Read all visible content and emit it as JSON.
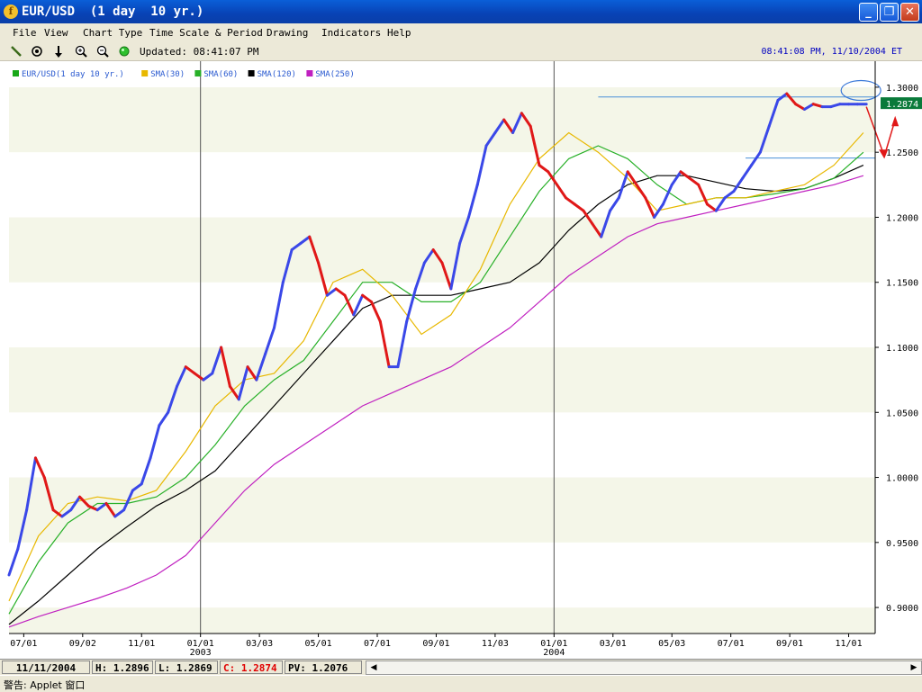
{
  "window": {
    "title": "EUR/USD  (1 day  10 yr.)",
    "app_icon": "forex-logo-icon",
    "buttons": [
      "minimize",
      "maximize",
      "close"
    ]
  },
  "menu": [
    "File",
    "View",
    "Chart Type",
    "Time Scale & Period",
    "Drawing",
    "Indicators",
    "Help"
  ],
  "toolbar": {
    "tools": [
      "pencil-icon",
      "crosshair-icon",
      "arrow-down-icon",
      "zoom-in-icon",
      "zoom-out-icon",
      "refresh-icon"
    ],
    "updated": "Updated: 08:41:07 PM",
    "timestamp": "08:41:08 PM, 11/10/2004 ET"
  },
  "legend": [
    {
      "label": "EUR/USD(1 day  10 yr.)",
      "color": "#18a818"
    },
    {
      "label": "SMA(30)",
      "color": "#e8b800"
    },
    {
      "label": "SMA(60)",
      "color": "#28b028"
    },
    {
      "label": "SMA(120)",
      "color": "#000000"
    },
    {
      "label": "SMA(250)",
      "color": "#c020c0"
    }
  ],
  "chart_data": {
    "type": "line",
    "ylim": [
      0.88,
      1.32
    ],
    "y_ticks": [
      {
        "label": "1.3000",
        "value": 1.3
      },
      {
        "label": "1.2500",
        "value": 1.25
      },
      {
        "label": "1.2000",
        "value": 1.2
      },
      {
        "label": "1.1500",
        "value": 1.15
      },
      {
        "label": "1.1000",
        "value": 1.1
      },
      {
        "label": "1.0500",
        "value": 1.05
      },
      {
        "label": "1.0000",
        "value": 1.0
      },
      {
        "label": "0.9500",
        "value": 0.95
      },
      {
        "label": "0.9000",
        "value": 0.9
      }
    ],
    "x_ticks": [
      {
        "label": "07/01",
        "x": 0.5
      },
      {
        "label": "09/02",
        "x": 2.5
      },
      {
        "label": "11/01",
        "x": 4.5
      },
      {
        "label": "01/01",
        "x": 6.5
      },
      {
        "label": "03/03",
        "x": 8.5
      },
      {
        "label": "05/01",
        "x": 10.5
      },
      {
        "label": "07/01",
        "x": 12.5
      },
      {
        "label": "09/01",
        "x": 14.5
      },
      {
        "label": "11/03",
        "x": 16.5
      },
      {
        "label": "01/01",
        "x": 18.5
      },
      {
        "label": "03/01",
        "x": 20.5
      },
      {
        "label": "05/03",
        "x": 22.5
      },
      {
        "label": "07/01",
        "x": 24.5
      },
      {
        "label": "09/01",
        "x": 26.5
      },
      {
        "label": "11/01",
        "x": 28.5
      }
    ],
    "year_labels": [
      {
        "label": "2003",
        "x": 6.5
      },
      {
        "label": "2004",
        "x": 18.5
      }
    ],
    "year_dividers": [
      6.5,
      18.5
    ],
    "xlim": [
      0,
      29.4
    ],
    "series": [
      {
        "name": "EUR/USD(1 day  10 yr.)",
        "x": [
          0,
          0.3,
          0.6,
          0.9,
          1.2,
          1.5,
          1.8,
          2.1,
          2.4,
          2.7,
          3.0,
          3.3,
          3.6,
          3.9,
          4.2,
          4.5,
          4.8,
          5.1,
          5.4,
          5.7,
          6.0,
          6.3,
          6.6,
          6.9,
          7.2,
          7.5,
          7.8,
          8.1,
          8.4,
          8.7,
          9.0,
          9.3,
          9.6,
          9.9,
          10.2,
          10.5,
          10.8,
          11.1,
          11.4,
          11.7,
          12.0,
          12.3,
          12.6,
          12.9,
          13.2,
          13.5,
          13.8,
          14.1,
          14.4,
          14.7,
          15.0,
          15.3,
          15.6,
          15.9,
          16.2,
          16.5,
          16.8,
          17.1,
          17.4,
          17.7,
          18.0,
          18.3,
          18.6,
          18.9,
          19.2,
          19.5,
          19.8,
          20.1,
          20.4,
          20.7,
          21.0,
          21.3,
          21.6,
          21.9,
          22.2,
          22.5,
          22.8,
          23.1,
          23.4,
          23.7,
          24.0,
          24.3,
          24.6,
          24.9,
          25.2,
          25.5,
          25.8,
          26.1,
          26.4,
          26.7,
          27.0,
          27.3,
          27.6,
          27.9,
          28.2,
          28.5,
          28.8,
          29.1
        ],
        "values": [
          0.925,
          0.945,
          0.975,
          1.015,
          1.0,
          0.975,
          0.97,
          0.975,
          0.985,
          0.978,
          0.975,
          0.98,
          0.97,
          0.975,
          0.99,
          0.995,
          1.015,
          1.04,
          1.05,
          1.07,
          1.085,
          1.08,
          1.075,
          1.08,
          1.1,
          1.07,
          1.06,
          1.085,
          1.075,
          1.095,
          1.115,
          1.15,
          1.175,
          1.18,
          1.185,
          1.165,
          1.14,
          1.145,
          1.14,
          1.125,
          1.14,
          1.135,
          1.12,
          1.085,
          1.085,
          1.12,
          1.145,
          1.165,
          1.175,
          1.165,
          1.145,
          1.18,
          1.2,
          1.225,
          1.255,
          1.265,
          1.275,
          1.265,
          1.28,
          1.27,
          1.24,
          1.235,
          1.225,
          1.215,
          1.21,
          1.205,
          1.195,
          1.185,
          1.205,
          1.215,
          1.235,
          1.225,
          1.215,
          1.2,
          1.21,
          1.225,
          1.235,
          1.23,
          1.225,
          1.21,
          1.205,
          1.215,
          1.22,
          1.23,
          1.24,
          1.25,
          1.27,
          1.29,
          1.295,
          1.287,
          1.283,
          1.287,
          1.285,
          1.285,
          1.287,
          1.287,
          1.287,
          1.287
        ],
        "color": "#3a48e8"
      },
      {
        "name": "SMA(30)",
        "x": [
          0,
          1,
          2,
          3,
          4,
          5,
          6,
          7,
          8,
          9,
          10,
          11,
          12,
          13,
          14,
          15,
          16,
          17,
          18,
          19,
          20,
          21,
          22,
          23,
          24,
          25,
          26,
          27,
          28,
          29
        ],
        "values": [
          0.905,
          0.955,
          0.98,
          0.985,
          0.982,
          0.99,
          1.02,
          1.055,
          1.075,
          1.08,
          1.105,
          1.15,
          1.16,
          1.14,
          1.11,
          1.125,
          1.16,
          1.21,
          1.245,
          1.265,
          1.25,
          1.23,
          1.205,
          1.21,
          1.215,
          1.215,
          1.22,
          1.225,
          1.24,
          1.265
        ],
        "color": "#e8b800"
      },
      {
        "name": "SMA(60)",
        "x": [
          0,
          1,
          2,
          3,
          4,
          5,
          6,
          7,
          8,
          9,
          10,
          11,
          12,
          13,
          14,
          15,
          16,
          17,
          18,
          19,
          20,
          21,
          22,
          23,
          24,
          25,
          26,
          27,
          28,
          29
        ],
        "values": [
          0.895,
          0.935,
          0.965,
          0.98,
          0.98,
          0.985,
          1.0,
          1.025,
          1.055,
          1.075,
          1.09,
          1.12,
          1.15,
          1.15,
          1.135,
          1.135,
          1.15,
          1.185,
          1.22,
          1.245,
          1.255,
          1.245,
          1.225,
          1.21,
          1.215,
          1.215,
          1.218,
          1.222,
          1.23,
          1.25
        ],
        "color": "#28b028"
      },
      {
        "name": "SMA(120)",
        "x": [
          0,
          1,
          2,
          3,
          4,
          5,
          6,
          7,
          8,
          9,
          10,
          11,
          12,
          13,
          14,
          15,
          16,
          17,
          18,
          19,
          20,
          21,
          22,
          23,
          24,
          25,
          26,
          27,
          28,
          29
        ],
        "values": [
          0.887,
          0.905,
          0.925,
          0.945,
          0.962,
          0.978,
          0.99,
          1.005,
          1.03,
          1.055,
          1.08,
          1.105,
          1.13,
          1.14,
          1.14,
          1.14,
          1.145,
          1.15,
          1.165,
          1.19,
          1.21,
          1.225,
          1.232,
          1.232,
          1.227,
          1.222,
          1.22,
          1.222,
          1.23,
          1.24
        ],
        "color": "#000000"
      },
      {
        "name": "SMA(250)",
        "x": [
          0,
          1,
          2,
          3,
          4,
          5,
          6,
          7,
          8,
          9,
          10,
          11,
          12,
          13,
          14,
          15,
          16,
          17,
          18,
          19,
          20,
          21,
          22,
          23,
          24,
          25,
          26,
          27,
          28,
          29
        ],
        "values": [
          0.885,
          0.893,
          0.9,
          0.907,
          0.915,
          0.925,
          0.94,
          0.965,
          0.99,
          1.01,
          1.025,
          1.04,
          1.055,
          1.065,
          1.075,
          1.085,
          1.1,
          1.115,
          1.135,
          1.155,
          1.17,
          1.185,
          1.195,
          1.2,
          1.205,
          1.21,
          1.215,
          1.22,
          1.225,
          1.232
        ],
        "color": "#c020c0"
      }
    ],
    "reference_lines": [
      {
        "y": 1.2925,
        "x_from": 20.0,
        "x_to": 29.4,
        "color": "#4a90d8"
      },
      {
        "y": 1.2455,
        "x_from": 25.0,
        "x_to": 29.4,
        "color": "#4a90d8"
      }
    ],
    "current_price": {
      "label": "1.2874",
      "value": 1.2874
    },
    "annotations": [
      "circle-marker-peak",
      "red-arrow-down",
      "red-arrow-up"
    ],
    "background_bands": [
      "#f4f6e8",
      "#ffffff"
    ]
  },
  "status": {
    "date": "11/11/2004",
    "high": "H: 1.2896",
    "low": "L: 1.2869",
    "close": "C: 1.2874",
    "pv": "PV: 1.2076"
  },
  "applet_bar": "警告: Applet 窗口"
}
